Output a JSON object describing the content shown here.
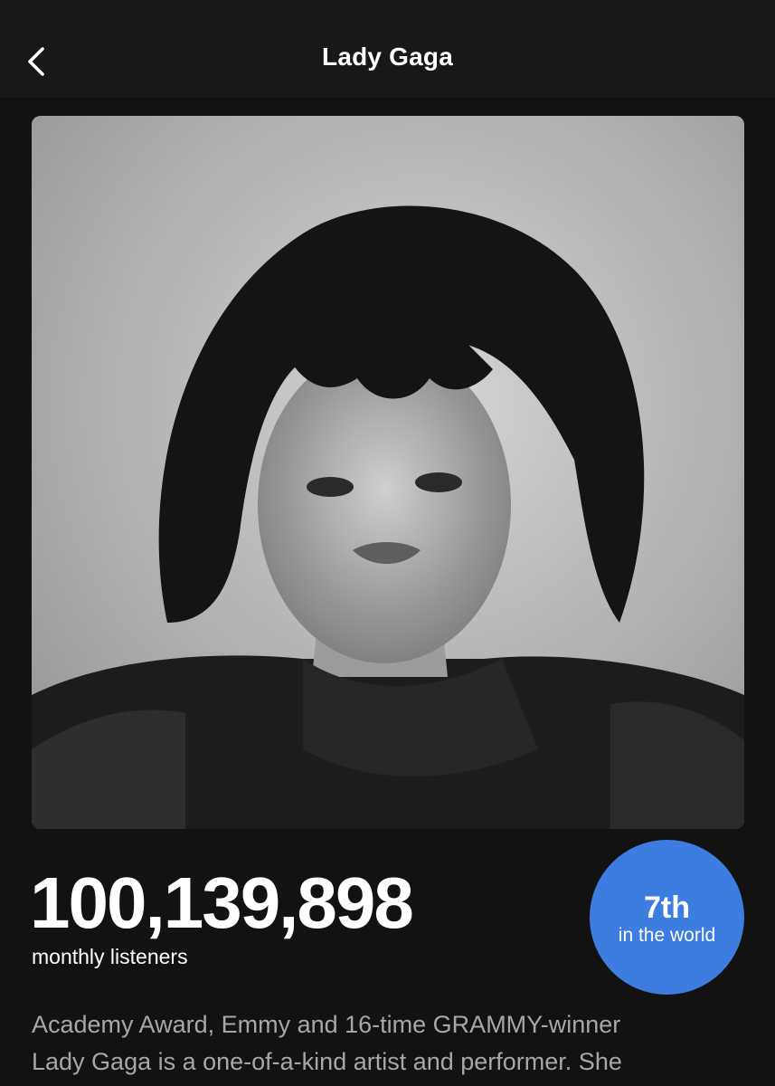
{
  "header": {
    "title": "Lady Gaga",
    "back_icon": "chevron-left-icon"
  },
  "artist": {
    "photo_description": "artist-portrait"
  },
  "stats": {
    "monthly_listeners": "100,139,898",
    "monthly_listeners_label": "monthly listeners",
    "rank": "7th",
    "rank_label": "in the world",
    "rank_badge_color": "#3d7de0"
  },
  "about": {
    "line1": "Academy Award, Emmy and 16-time GRAMMY-winner",
    "line2": "Lady Gaga is a one-of-a-kind artist and performer. She"
  }
}
